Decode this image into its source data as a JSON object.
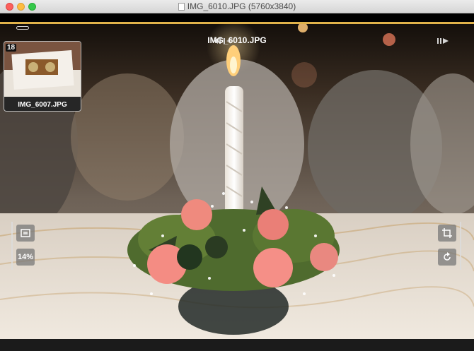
{
  "window": {
    "title": "IMG_6010.JPG (5760x3840)"
  },
  "viewer": {
    "current_file": "IMG_6010.JPG",
    "thumbnail": {
      "badge": "18",
      "label": "IMG_6007.JPG"
    },
    "zoom": "14%",
    "accent_color": "#e0b24a"
  },
  "icons": {
    "prev": "step-back-icon",
    "next": "step-forward-icon",
    "fit": "fit-screen-icon",
    "crop": "crop-icon",
    "rotate": "rotate-icon"
  }
}
